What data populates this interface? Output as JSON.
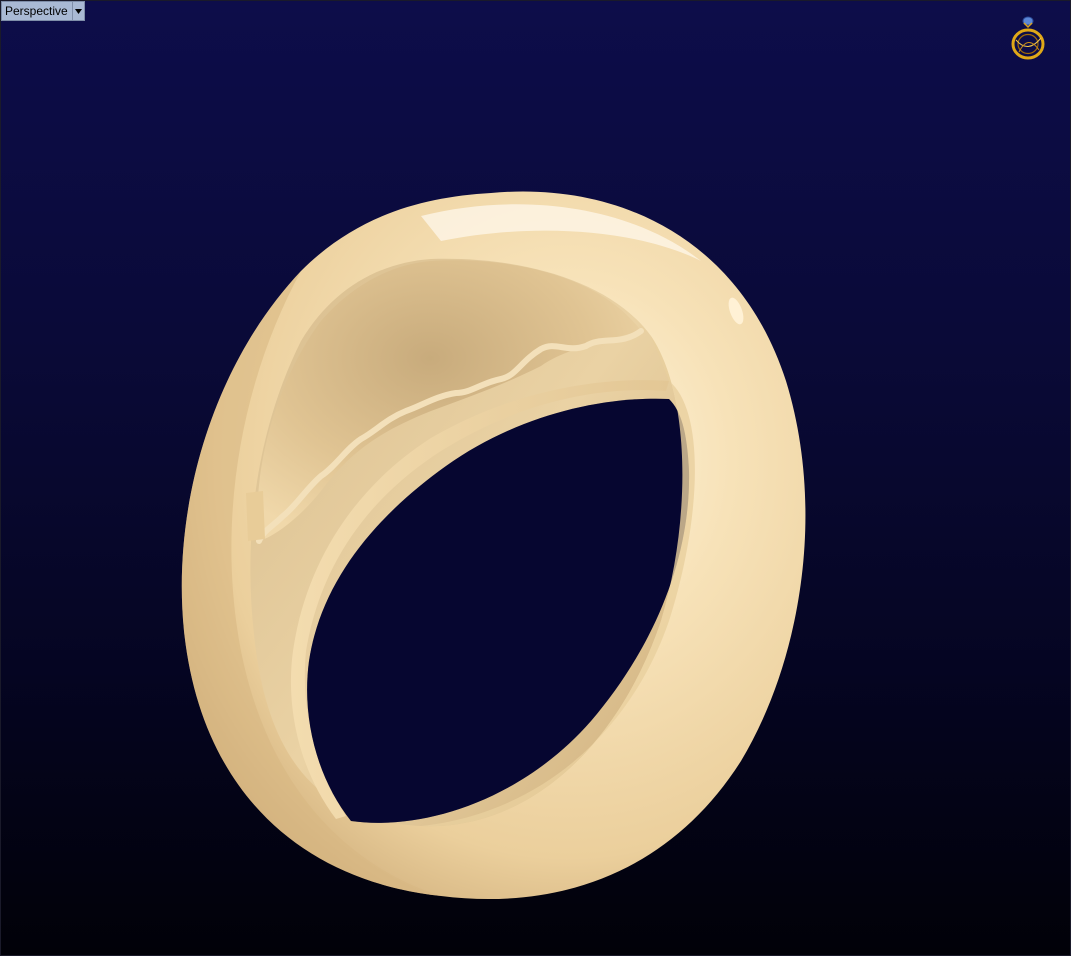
{
  "viewport": {
    "label": "Perspective",
    "background_top": "#0d0d4a",
    "background_bottom": "#010108"
  },
  "model": {
    "material_color": "#f2d9a8",
    "shadow_color": "#b89a6a"
  },
  "icons": {
    "viewport_menu": "chevron-down-icon",
    "ring_widget": "ring-icon"
  }
}
